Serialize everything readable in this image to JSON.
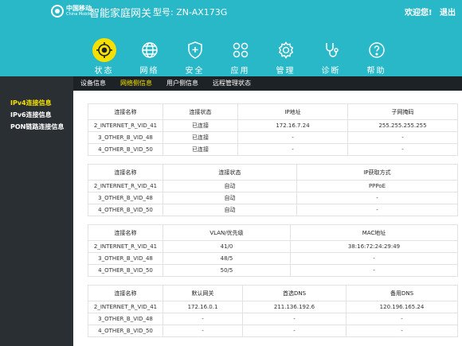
{
  "header": {
    "logo_cn": "中国移动",
    "logo_en": "China Mobile",
    "title": "智能家庭网关",
    "model": "型号: ZN-AX173G",
    "welcome": "欢迎您!",
    "logout": "退出"
  },
  "nav": [
    {
      "label": "状态",
      "icon": "status-icon",
      "active": true
    },
    {
      "label": "网络",
      "icon": "globe-icon"
    },
    {
      "label": "安全",
      "icon": "shield-icon"
    },
    {
      "label": "应用",
      "icon": "apps-icon"
    },
    {
      "label": "管理",
      "icon": "gear-icon"
    },
    {
      "label": "诊断",
      "icon": "stethoscope-icon"
    },
    {
      "label": "帮助",
      "icon": "help-icon"
    }
  ],
  "subnav": [
    "设备信息",
    "网络侧信息",
    "用户侧信息",
    "远程管理状态"
  ],
  "sidebar": [
    "IPv4连接信息",
    "IPv6连接信息",
    "PON链路连接信息"
  ],
  "colors": {
    "header": "#29b8c8",
    "accent": "#f5e000",
    "dark": "#1d2226"
  },
  "tables": [
    {
      "headers": [
        "连接名称",
        "连接状态",
        "IP地址",
        "子网掩码"
      ],
      "rows": [
        [
          "2_INTERNET_R_VID_41",
          "已连接",
          "172.16.7.24",
          "255.255.255.255"
        ],
        [
          "3_OTHER_B_VID_48",
          "已连接",
          "-",
          "-"
        ],
        [
          "4_OTHER_B_VID_50",
          "已连接",
          "-",
          "-"
        ]
      ]
    },
    {
      "headers": [
        "连接名称",
        "连接状态",
        "IP获取方式"
      ],
      "rows": [
        [
          "2_INTERNET_R_VID_41",
          "自动",
          "PPPoE"
        ],
        [
          "3_OTHER_B_VID_48",
          "自动",
          "-"
        ],
        [
          "4_OTHER_B_VID_50",
          "自动",
          "-"
        ]
      ]
    },
    {
      "headers": [
        "连接名称",
        "VLAN/优先级",
        "MAC地址"
      ],
      "rows": [
        [
          "2_INTERNET_R_VID_41",
          "41/0",
          "38:16:72:24:29:49"
        ],
        [
          "3_OTHER_B_VID_48",
          "48/5",
          "-"
        ],
        [
          "4_OTHER_B_VID_50",
          "50/5",
          "-"
        ]
      ]
    },
    {
      "headers": [
        "连接名称",
        "默认网关",
        "首选DNS",
        "备用DNS"
      ],
      "rows": [
        [
          "2_INTERNET_R_VID_41",
          "172.16.0.1",
          "211.136.192.6",
          "120.196.165.24"
        ],
        [
          "3_OTHER_B_VID_48",
          "-",
          "-",
          "-"
        ],
        [
          "4_OTHER_B_VID_50",
          "-",
          "-",
          "-"
        ]
      ]
    }
  ]
}
